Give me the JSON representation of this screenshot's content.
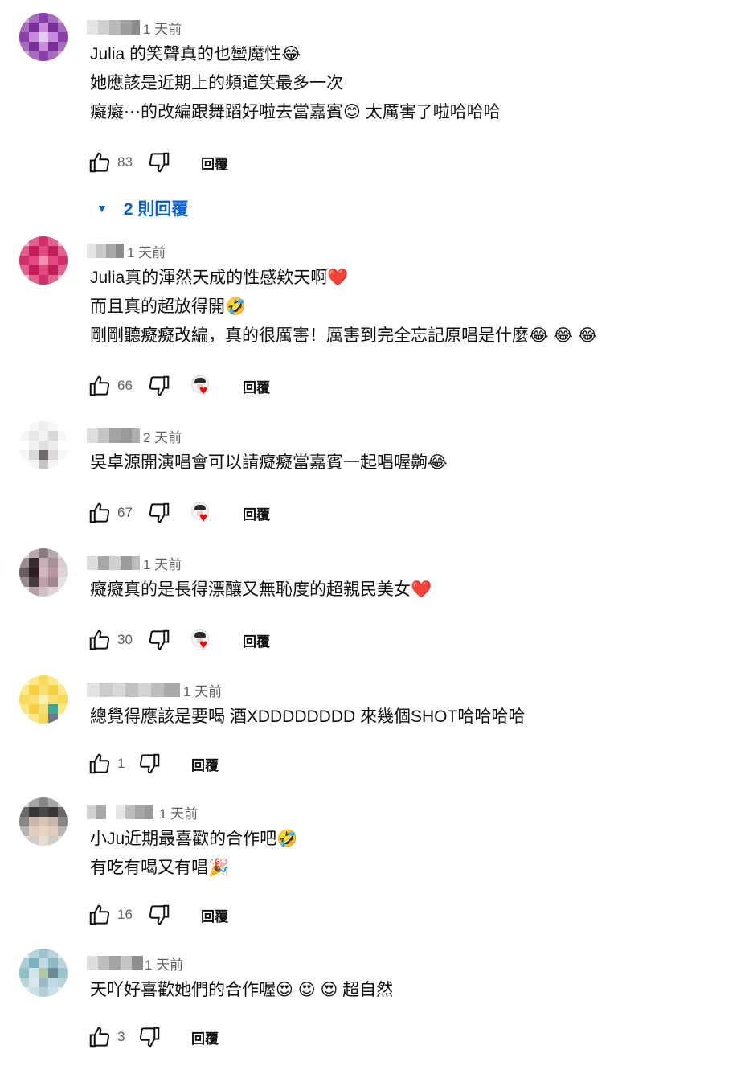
{
  "icons": {
    "like": "thumbs-up-icon",
    "dislike": "thumbs-down-icon",
    "heart": "creator-heart-icon",
    "caret": "caret-down-icon"
  },
  "colors": {
    "link_blue": "#065fd4",
    "muted_text": "#606060",
    "heart_red": "#ff0000"
  },
  "reply_label": "回覆",
  "comments": [
    {
      "time": "1 天前",
      "lines": [
        "Julia 的笑聲真的也蠻魔性😂",
        "她應該是近期上的頻道笑最多一次",
        "癡癡⋯的改編跟舞蹈好啦去當嘉賓😊 太厲害了啦哈哈哈"
      ],
      "likes": "83",
      "hearted": false,
      "replies_label": "2 則回覆"
    },
    {
      "time": "1 天前",
      "lines": [
        "Julia真的渾然天成的性感欸天啊❤️",
        "而且真的超放得開🤣",
        "剛剛聽癡癡改編，真的很厲害！厲害到完全忘記原唱是什麼😂 😂 😂"
      ],
      "likes": "66",
      "hearted": true
    },
    {
      "time": "2 天前",
      "lines": [
        "吳卓源開演唱會可以請癡癡當嘉賓一起唱喔齁😂"
      ],
      "likes": "67",
      "hearted": true
    },
    {
      "time": "1 天前",
      "lines": [
        "癡癡真的是長得漂釀又無恥度的超親民美女❤️"
      ],
      "likes": "30",
      "hearted": true
    },
    {
      "time": "1 天前",
      "lines": [
        "總覺得應該是要喝 酒XDDDDDDDD 來幾個SHOT哈哈哈哈"
      ],
      "likes": "1",
      "hearted": false
    },
    {
      "time": "1 天前",
      "lines": [
        "小Ju近期最喜歡的合作吧🤣",
        "有吃有喝又有唱🎉"
      ],
      "likes": "16",
      "hearted": false
    },
    {
      "time": "1 天前",
      "lines": [
        "天吖好喜歡她們的合作喔😍 😍 😍 超自然"
      ],
      "likes": "3",
      "hearted": false
    }
  ]
}
